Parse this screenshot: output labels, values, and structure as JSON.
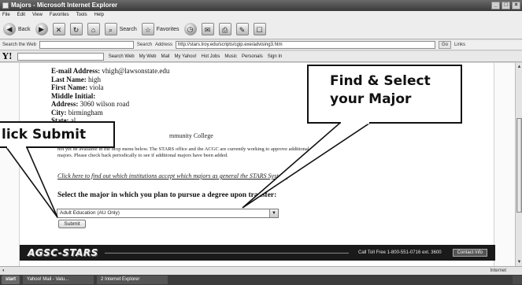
{
  "window": {
    "title": "Majors - Microsoft Internet Explorer"
  },
  "menu": [
    "File",
    "Edit",
    "View",
    "Favorites",
    "Tools",
    "Help"
  ],
  "toolbar": {
    "back_label": "Back",
    "search_label": "Search",
    "favorites_label": "Favorites"
  },
  "address_bar": {
    "search_web_label": "Search the Web",
    "search_button": "Search",
    "address_label": "Address",
    "url": "http://stars.troy.edu/scripts/cgip.exe/advising3.htm",
    "go_label": "Go",
    "links_label": "Links"
  },
  "yahoo_toolbar": {
    "search_web": "Search Web",
    "items": [
      "My Web",
      "Mail",
      "My Yahoo!",
      "Hot Jobs",
      "Music",
      "Personals",
      "Sign In"
    ]
  },
  "student": {
    "email_label": "E-mail Address:",
    "email": "vhigh@lawsonstate.edu",
    "last_label": "Last Name:",
    "last": "high",
    "first_label": "First Name:",
    "first": "viola",
    "middle_label": "Middle Initial:",
    "middle": "",
    "address_label": "Address:",
    "address": "3060 wilson road",
    "city_label": "City:",
    "city": "birmingham",
    "state_label": "State:",
    "state": "al"
  },
  "college_text": "mmunity College",
  "notice_text": "not yet be available in the drop menu below. The STARS office and the ACGC are currently working to approve additional majors. Please check back periodically to see if additional majors have been added.",
  "institutions_link": "Click here to find out which institutions accept which majors as general the STARS System.",
  "select_label": "Select the major in which you plan to pursue a degree upon transfer:",
  "major_select": {
    "selected": "Adult Education (AU Only)"
  },
  "submit_label": "Submit",
  "footer": {
    "logo": "AGSC-STARS",
    "phone": "Call Toll Free 1-800-551-0716 ext. 3600",
    "contact": "Contact Info"
  },
  "callouts": {
    "find_major": "Find & Select your Major",
    "click_submit": "lick Submit"
  },
  "status": {
    "zone": "Internet"
  },
  "taskbar": {
    "start": "start",
    "tasks": [
      "Yahoo! Mail - Valu...",
      "2 Internet Explorer"
    ],
    "clock": ""
  },
  "colors": {
    "callout_border": "#111111",
    "footer_bg": "#1a1a1a"
  }
}
